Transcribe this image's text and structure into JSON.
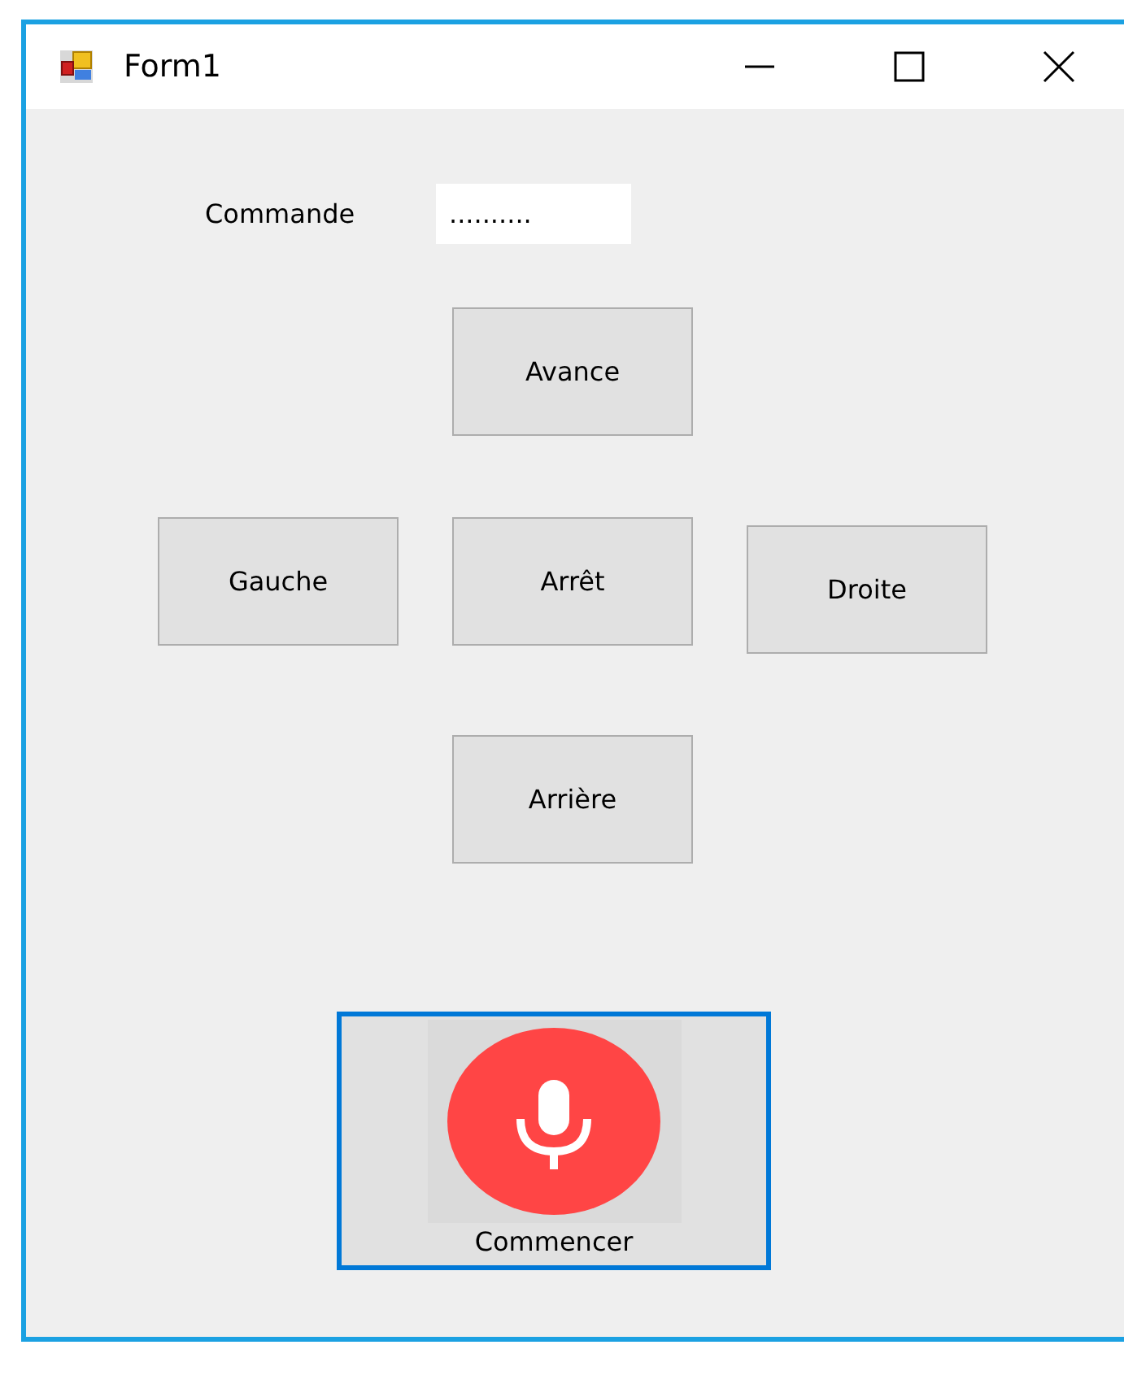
{
  "window": {
    "title": "Form1"
  },
  "command": {
    "label": "Commande",
    "value": ".........."
  },
  "direction_buttons": [
    {
      "label": "Avance"
    },
    {
      "label": "Gauche"
    },
    {
      "label": "Arrêt"
    },
    {
      "label": "Droite"
    },
    {
      "label": "Arrière"
    }
  ],
  "start_button": {
    "label": "Commencer"
  }
}
